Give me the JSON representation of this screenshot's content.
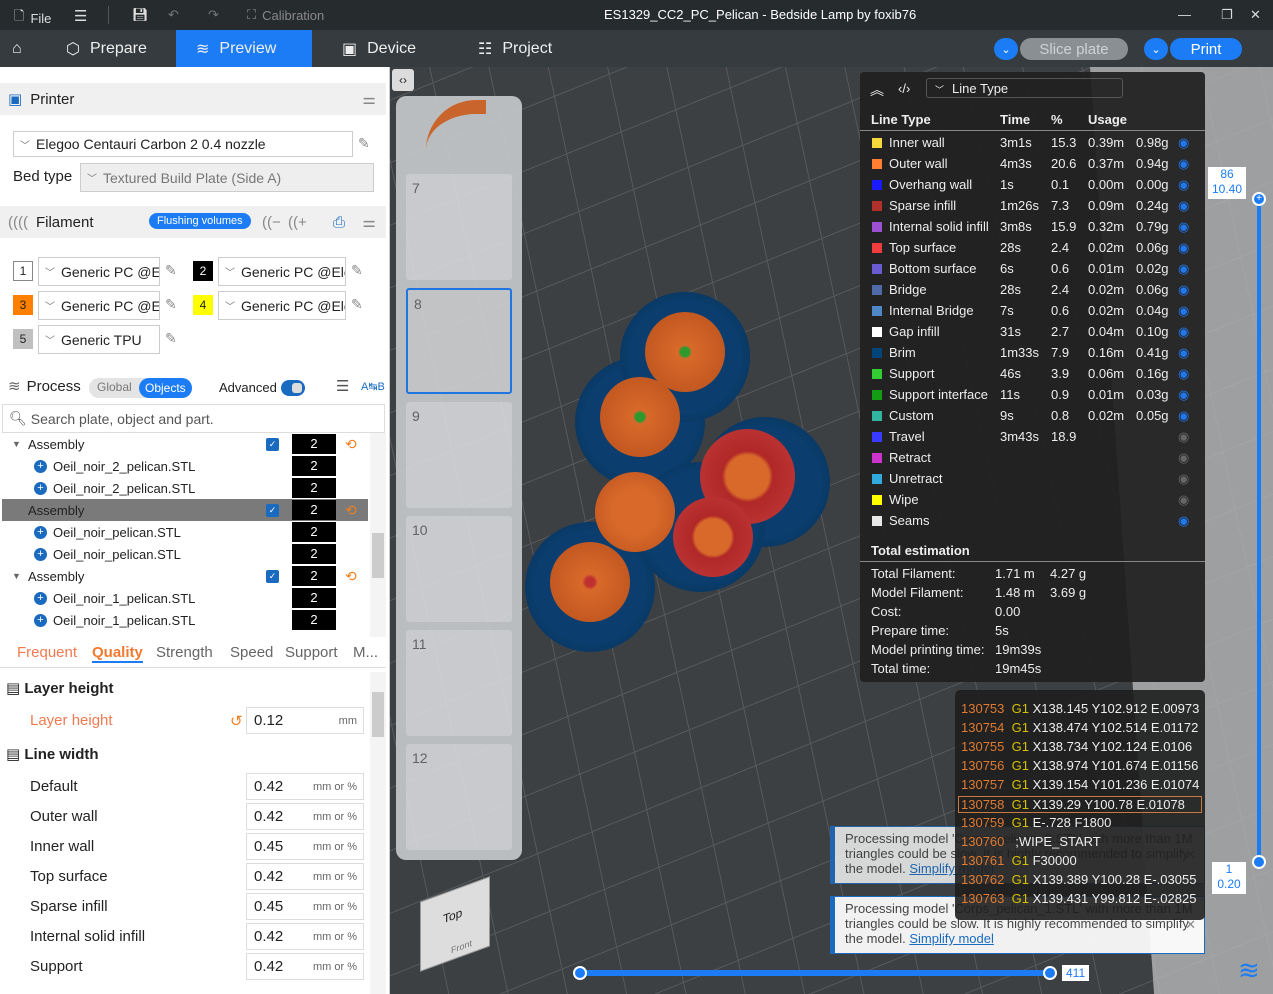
{
  "titlebar": {
    "file": "File",
    "calibration": "Calibration",
    "title": "ES1329_CC2_PC_Pelican - Bedside Lamp by foxib76"
  },
  "nav": {
    "prepare": "Prepare",
    "preview": "Preview",
    "device": "Device",
    "project": "Project",
    "slice": "Slice plate",
    "print": "Print"
  },
  "printer": {
    "header": "Printer",
    "name": "Elegoo Centauri Carbon 2 0.4 nozzle",
    "bed_label": "Bed type",
    "bed_value": "Textured Build Plate (Side A)"
  },
  "filament": {
    "header": "Filament",
    "flushing": "Flushing volumes",
    "items": [
      {
        "num": "1",
        "name": "Generic PC @E...",
        "color": "#ffffff"
      },
      {
        "num": "2",
        "name": "Generic PC @Ele...",
        "color": "#000000"
      },
      {
        "num": "3",
        "name": "Generic PC @E...",
        "color": "#ff7f00"
      },
      {
        "num": "4",
        "name": "Generic PC @Ele...",
        "color": "#ffff00"
      },
      {
        "num": "5",
        "name": "Generic TPU",
        "color": "#c0c0c0"
      }
    ]
  },
  "process": {
    "header": "Process",
    "global": "Global",
    "objects": "Objects",
    "advanced": "Advanced",
    "search_placeholder": "Search plate, object and part.",
    "tree": [
      {
        "label": "Assembly",
        "type": "group",
        "count": "2"
      },
      {
        "label": "Oeil_noir_2_pelican.STL",
        "type": "part",
        "count": "2"
      },
      {
        "label": "Oeil_noir_2_pelican.STL",
        "type": "part",
        "count": "2"
      },
      {
        "label": "Assembly",
        "type": "group-selected",
        "count": "2"
      },
      {
        "label": "Oeil_noir_pelican.STL",
        "type": "part",
        "count": "2"
      },
      {
        "label": "Oeil_noir_pelican.STL",
        "type": "part",
        "count": "2"
      },
      {
        "label": "Assembly",
        "type": "group",
        "count": "2"
      },
      {
        "label": "Oeil_noir_1_pelican.STL",
        "type": "part",
        "count": "2"
      },
      {
        "label": "Oeil_noir_1_pelican.STL",
        "type": "part",
        "count": "2"
      }
    ],
    "tabs": [
      "Frequent",
      "Quality",
      "Strength",
      "Speed",
      "Support",
      "M..."
    ],
    "layer_height_section": "Layer height",
    "layer_height_label": "Layer height",
    "layer_height": "0.12",
    "mm": "mm",
    "line_width_section": "Line width",
    "mm_or_pct": "mm or %",
    "line_widths": [
      {
        "label": "Default",
        "value": "0.42"
      },
      {
        "label": "Outer wall",
        "value": "0.42"
      },
      {
        "label": "Inner wall",
        "value": "0.45"
      },
      {
        "label": "Top surface",
        "value": "0.42"
      },
      {
        "label": "Sparse infill",
        "value": "0.45"
      },
      {
        "label": "Internal solid infill",
        "value": "0.42"
      },
      {
        "label": "Support",
        "value": "0.42"
      }
    ]
  },
  "plates": [
    "7",
    "8",
    "9",
    "10",
    "11",
    "12"
  ],
  "legend": {
    "dropdown": "Line Type",
    "headers": [
      "Line Type",
      "Time",
      "%",
      "Usage"
    ],
    "rows": [
      {
        "name": "Inner wall",
        "color": "#f5d83c",
        "time": "3m1s",
        "pct": "15.3",
        "m": "0.39m",
        "g": "0.98g",
        "visible": true
      },
      {
        "name": "Outer wall",
        "color": "#ff7f32",
        "time": "4m3s",
        "pct": "20.6",
        "m": "0.37m",
        "g": "0.94g",
        "visible": true
      },
      {
        "name": "Overhang wall",
        "color": "#1a1aff",
        "time": "1s",
        "pct": "0.1",
        "m": "0.00m",
        "g": "0.00g",
        "visible": true
      },
      {
        "name": "Sparse infill",
        "color": "#b0302a",
        "time": "1m26s",
        "pct": "7.3",
        "m": "0.09m",
        "g": "0.24g",
        "visible": true
      },
      {
        "name": "Internal solid infill",
        "color": "#9a50d0",
        "time": "3m8s",
        "pct": "15.9",
        "m": "0.32m",
        "g": "0.79g",
        "visible": true
      },
      {
        "name": "Top surface",
        "color": "#f03c3c",
        "time": "28s",
        "pct": "2.4",
        "m": "0.02m",
        "g": "0.06g",
        "visible": true
      },
      {
        "name": "Bottom surface",
        "color": "#6a5cd0",
        "time": "6s",
        "pct": "0.6",
        "m": "0.01m",
        "g": "0.02g",
        "visible": true
      },
      {
        "name": "Bridge",
        "color": "#4f6aa8",
        "time": "28s",
        "pct": "2.4",
        "m": "0.02m",
        "g": "0.06g",
        "visible": true
      },
      {
        "name": "Internal Bridge",
        "color": "#4f88c8",
        "time": "7s",
        "pct": "0.6",
        "m": "0.02m",
        "g": "0.04g",
        "visible": true
      },
      {
        "name": "Gap infill",
        "color": "#ffffff",
        "time": "31s",
        "pct": "2.7",
        "m": "0.04m",
        "g": "0.10g",
        "visible": true
      },
      {
        "name": "Brim",
        "color": "#00457a",
        "time": "1m33s",
        "pct": "7.9",
        "m": "0.16m",
        "g": "0.41g",
        "visible": true
      },
      {
        "name": "Support",
        "color": "#33cc33",
        "time": "46s",
        "pct": "3.9",
        "m": "0.06m",
        "g": "0.16g",
        "visible": true
      },
      {
        "name": "Support interface",
        "color": "#149c14",
        "time": "11s",
        "pct": "0.9",
        "m": "0.01m",
        "g": "0.03g",
        "visible": true
      },
      {
        "name": "Custom",
        "color": "#2fb5a0",
        "time": "9s",
        "pct": "0.8",
        "m": "0.02m",
        "g": "0.05g",
        "visible": true
      },
      {
        "name": "Travel",
        "color": "#3a3aff",
        "time": "3m43s",
        "pct": "18.9",
        "m": "",
        "g": "",
        "visible": false
      },
      {
        "name": "Retract",
        "color": "#cc33cc",
        "time": "",
        "pct": "",
        "m": "",
        "g": "",
        "visible": false
      },
      {
        "name": "Unretract",
        "color": "#33aadd",
        "time": "",
        "pct": "",
        "m": "",
        "g": "",
        "visible": false
      },
      {
        "name": "Wipe",
        "color": "#ffff00",
        "time": "",
        "pct": "",
        "m": "",
        "g": "",
        "visible": false
      },
      {
        "name": "Seams",
        "color": "#e8e8e8",
        "time": "",
        "pct": "",
        "m": "",
        "g": "",
        "visible": true
      }
    ],
    "total_header": "Total estimation",
    "totals": [
      {
        "label": "Total Filament:",
        "v1": "1.71 m",
        "v2": "4.27 g"
      },
      {
        "label": "Model Filament:",
        "v1": "1.48 m",
        "v2": "3.69 g"
      },
      {
        "label": "Cost:",
        "v1": "0.00",
        "v2": ""
      },
      {
        "label": "Prepare time:",
        "v1": "5s",
        "v2": ""
      },
      {
        "label": "Model printing time:",
        "v1": "19m39s",
        "v2": ""
      },
      {
        "label": "Total time:",
        "v1": "19m45s",
        "v2": ""
      }
    ]
  },
  "gcode": [
    {
      "ln": "130753",
      "cmd": "G1",
      "rest": "X138.145 Y102.912 E.00973"
    },
    {
      "ln": "130754",
      "cmd": "G1",
      "rest": "X138.474 Y102.514 E.01172"
    },
    {
      "ln": "130755",
      "cmd": "G1",
      "rest": "X138.734 Y102.124 E.0106"
    },
    {
      "ln": "130756",
      "cmd": "G1",
      "rest": "X138.974 Y101.674 E.01156"
    },
    {
      "ln": "130757",
      "cmd": "G1",
      "rest": "X139.154 Y101.236 E.01074"
    },
    {
      "ln": "130758",
      "cmd": "G1",
      "rest": "X139.29 Y100.78 E.01078"
    },
    {
      "ln": "130759",
      "cmd": "G1",
      "rest": "E-.728 F1800"
    },
    {
      "ln": "130760",
      "cmd": "",
      "rest": ";WIPE_START"
    },
    {
      "ln": "130761",
      "cmd": "G1",
      "rest": "F30000"
    },
    {
      "ln": "130762",
      "cmd": "G1",
      "rest": "X139.389 Y100.28 E-.03055"
    },
    {
      "ln": "130763",
      "cmd": "G1",
      "rest": "X139.431 Y99.812 E-.02825"
    }
  ],
  "notifications": [
    {
      "text": "Processing model 'Corps_pelican_2.STL' with more than 1M triangles could be slow. It is highly recommended to simplify the model.",
      "link": "Simplify model"
    },
    {
      "text": "Processing model 'Corps_pelican_1.STL' with more than 1M triangles could be slow. It is highly recommended to simplify the model.",
      "link": "Simplify model"
    }
  ],
  "layer_slider": {
    "top_layer": "86",
    "top_height": "10.40",
    "bottom_layer": "1",
    "bottom_height": "0.20"
  },
  "move_slider": {
    "value": "411"
  },
  "view_cube": {
    "top": "Top",
    "front": "Front"
  }
}
